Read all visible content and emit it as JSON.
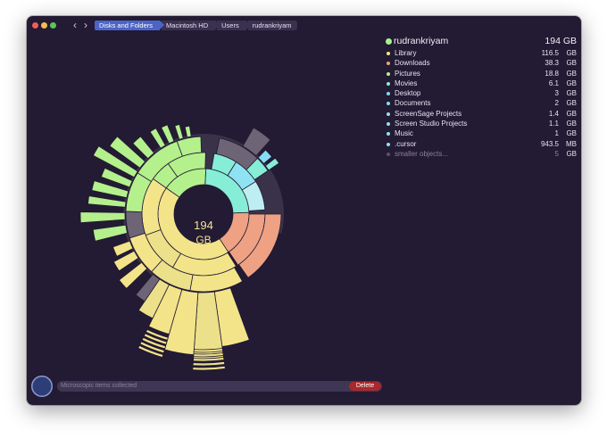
{
  "titlebar": {
    "nav_back": "‹",
    "nav_forward": "›",
    "breadcrumbs": [
      "Disks and Folders",
      "Macintosh HD",
      "Users",
      "rudrankriyam"
    ]
  },
  "center_label": {
    "value": "194",
    "unit": "GB"
  },
  "legend": {
    "root": {
      "name": "rudrankriyam",
      "size": "194 GB",
      "color": "#a7f28a"
    },
    "items": [
      {
        "name": "Library",
        "num": "116.5",
        "unit": "GB",
        "color": "#f3e48a"
      },
      {
        "name": "Downloads",
        "num": "38.3",
        "unit": "GB",
        "color": "#ec9f80"
      },
      {
        "name": "Pictures",
        "num": "18.8",
        "unit": "GB",
        "color": "#b2f28c"
      },
      {
        "name": "Movies",
        "num": "6.1",
        "unit": "GB",
        "color": "#86eed8"
      },
      {
        "name": "Desktop",
        "num": "3",
        "unit": "GB",
        "color": "#7fd8f2"
      },
      {
        "name": "Documents",
        "num": "2",
        "unit": "GB",
        "color": "#86dcf2"
      },
      {
        "name": "ScreenSage Projects",
        "num": "1.4",
        "unit": "GB",
        "color": "#8fe2f2"
      },
      {
        "name": "Screen Studio Projects",
        "num": "1.1",
        "unit": "GB",
        "color": "#8fe2f2"
      },
      {
        "name": "Music",
        "num": "1",
        "unit": "GB",
        "color": "#8fe2f2"
      },
      {
        "name": ".cursor",
        "num": "943.5",
        "unit": "MB",
        "color": "#8fe2f2"
      },
      {
        "name": "smaller objects...",
        "num": "5",
        "unit": "GB",
        "color": "#5a5266"
      }
    ]
  },
  "bottom": {
    "status": "Microscopic items collected",
    "delete_label": "Delete"
  }
}
